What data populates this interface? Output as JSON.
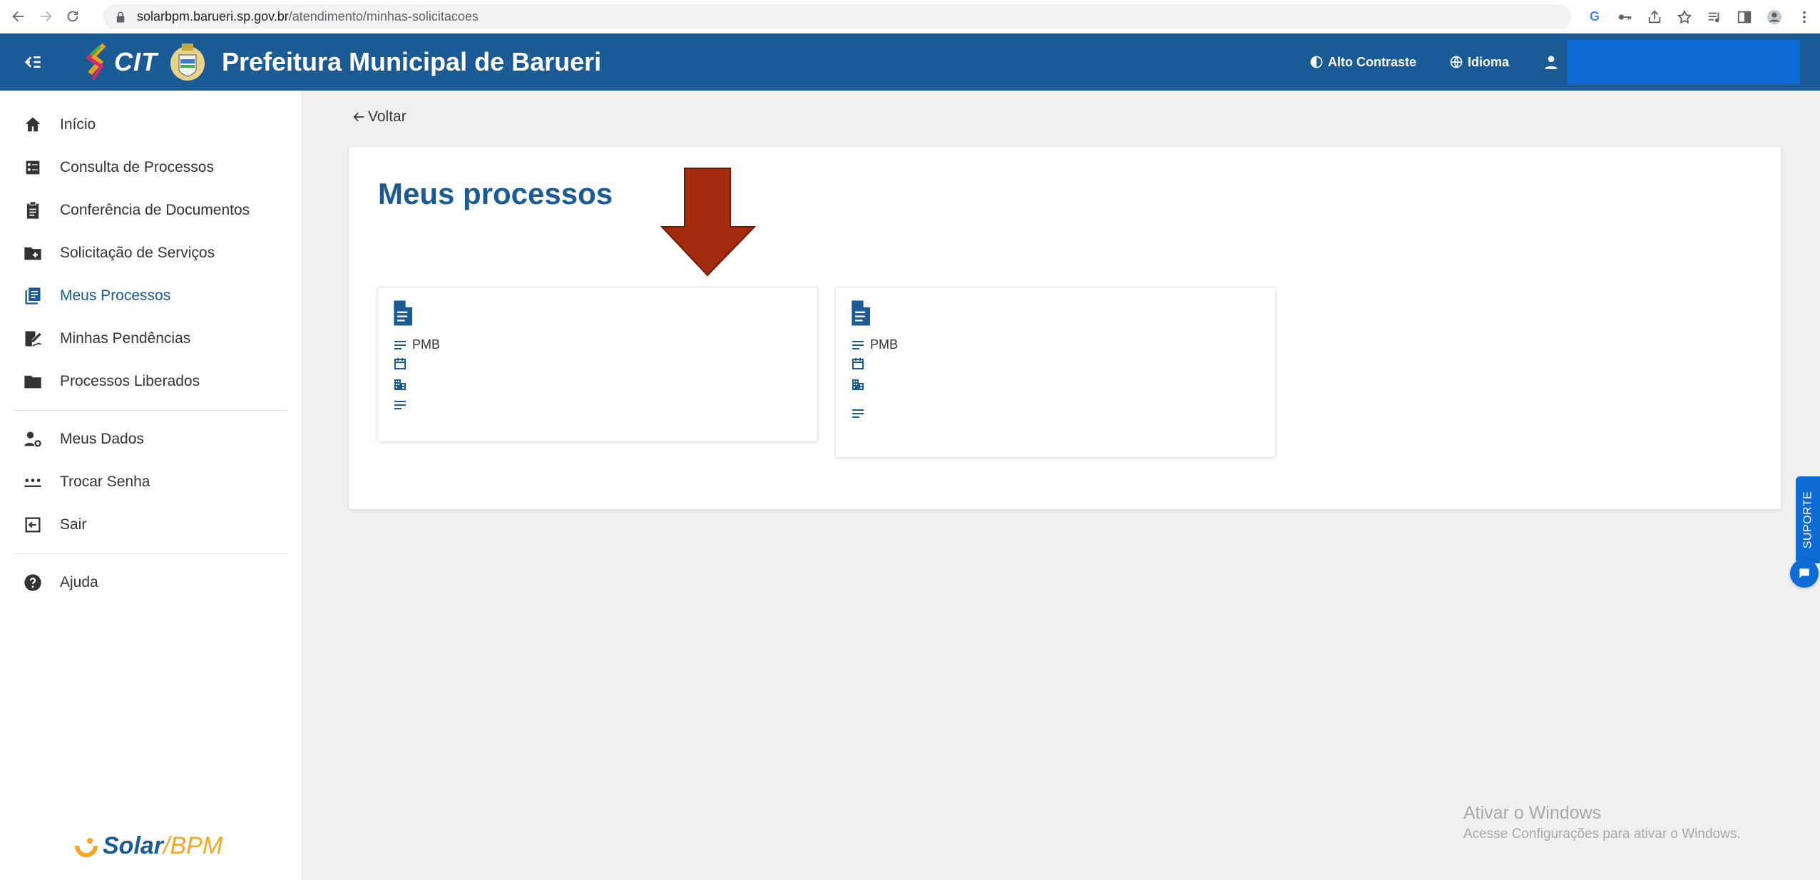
{
  "browser": {
    "url_host": "solarbpm.barueri.sp.gov.br",
    "url_path": "/atendimento/minhas-solicitacoes"
  },
  "header": {
    "title": "Prefeitura Municipal de Barueri",
    "logo_text": "CIT",
    "contrast_label": "Alto Contraste",
    "language_label": "Idioma"
  },
  "sidebar": {
    "items": [
      {
        "label": "Início",
        "icon": "home-icon"
      },
      {
        "label": "Consulta de Processos",
        "icon": "list-box-icon"
      },
      {
        "label": "Conferência de Documentos",
        "icon": "clipboard-icon"
      },
      {
        "label": "Solicitação de Serviços",
        "icon": "folder-plus-icon"
      },
      {
        "label": "Meus Processos",
        "icon": "document-list-icon",
        "active": true
      },
      {
        "label": "Minhas Pendências",
        "icon": "signature-icon"
      },
      {
        "label": "Processos Liberados",
        "icon": "folder-icon"
      }
    ],
    "account_items": [
      {
        "label": "Meus Dados",
        "icon": "user-settings-icon"
      },
      {
        "label": "Trocar Senha",
        "icon": "password-icon"
      },
      {
        "label": "Sair",
        "icon": "logout-icon"
      }
    ],
    "help_item": {
      "label": "Ajuda",
      "icon": "help-icon"
    },
    "footer_logo": {
      "solar": "Solar",
      "bpm": "/BPM"
    }
  },
  "main": {
    "back_label": "Voltar",
    "title": "Meus processos",
    "cards": [
      {
        "org": "PMB"
      },
      {
        "org": "PMB"
      }
    ]
  },
  "support": {
    "label": "SUPORTE"
  },
  "watermark": {
    "line1": "Ativar o Windows",
    "line2": "Acesse Configurações para ativar o Windows."
  },
  "colors": {
    "primary": "#1a5a95",
    "accent": "#0d6bd6",
    "arrow": "#a32a0d"
  }
}
